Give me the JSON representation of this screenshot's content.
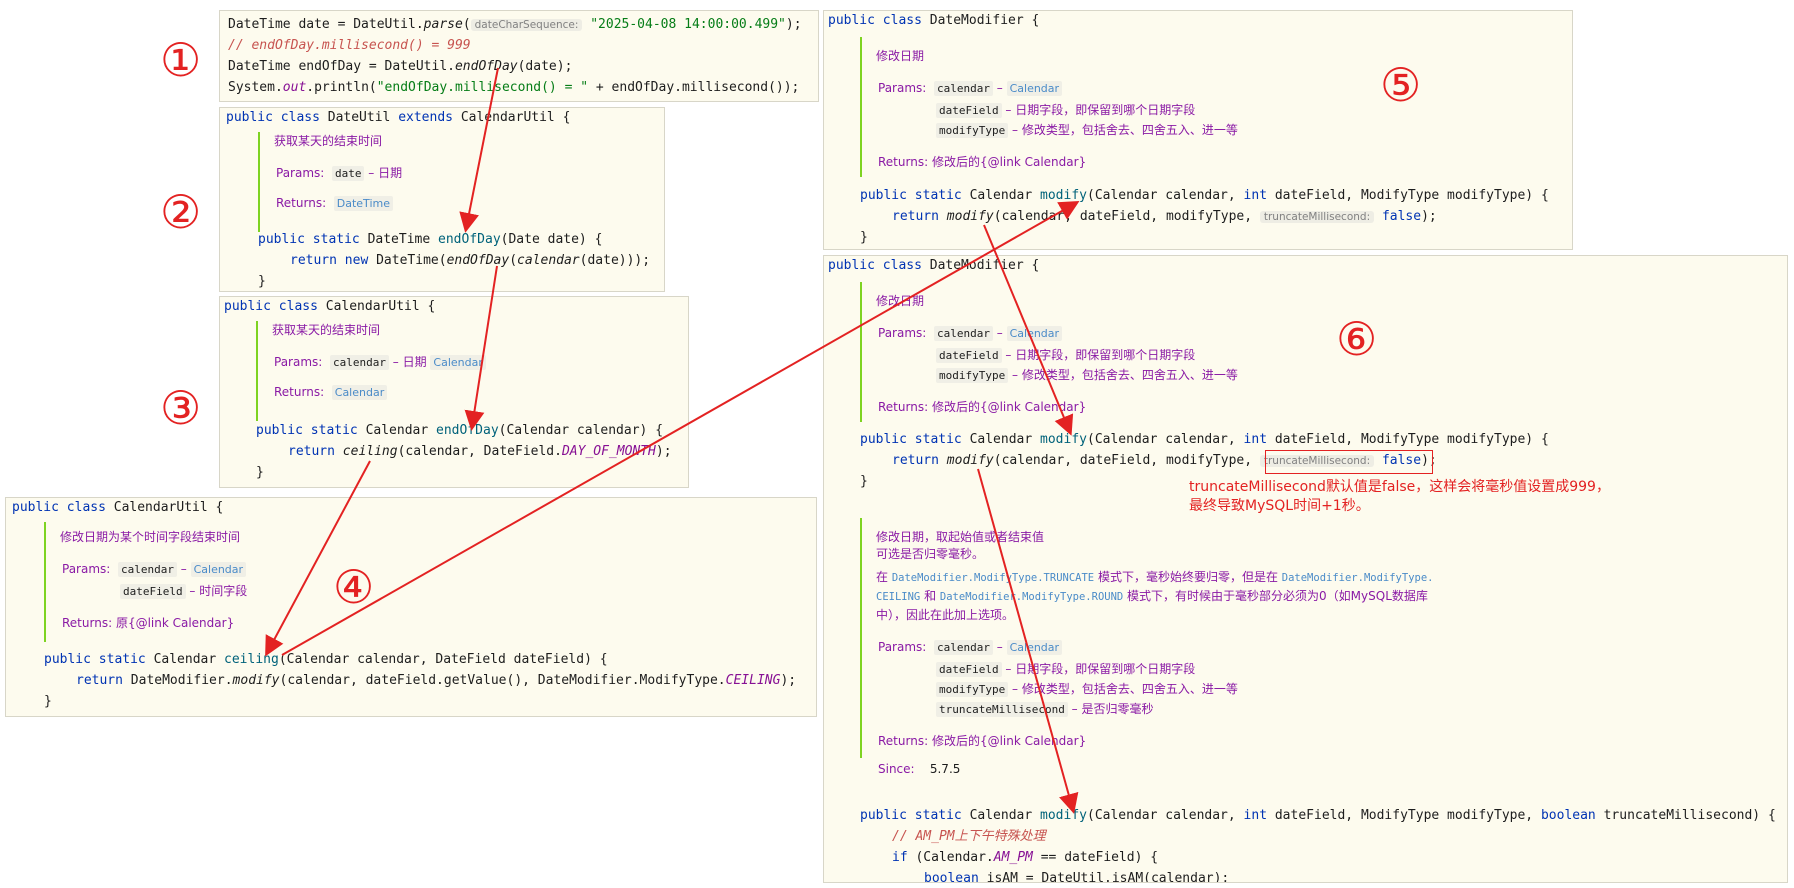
{
  "panel1": {
    "l1_a": "DateTime date = DateUtil.",
    "l1_fn": "parse",
    "l1_b": "(",
    "l1_hint": "dateCharSequence:",
    "l1_str": "\"2025-04-08 14:00:00.499\"",
    "l1_c": ");",
    "l2": "// endOfDay.millisecond() = 999",
    "l3_a": "DateTime endOfDay = DateUtil.",
    "l3_fn": "endOfDay",
    "l3_b": "(date);",
    "l4_a": "System.",
    "l4_out": "out",
    "l4_b": ".println(",
    "l4_str": "\"endOfDay.millisecond() = \"",
    "l4_c": " + endOfDay.millisecond());"
  },
  "panel2": {
    "header_kw": "public class",
    "header_name": " DateUtil ",
    "header_kw2": "extends",
    "header_rest": " CalendarUtil {",
    "doc_desc": "获取某天的结束时间",
    "doc_params": "Params:",
    "doc_param_name": "date",
    "doc_param_desc": " – 日期",
    "doc_returns": "Returns:",
    "doc_returns_type": "DateTime",
    "sig_kw": "public static",
    "sig_type": " DateTime ",
    "sig_fn": "endOfDay",
    "sig_rest": "(Date date) {",
    "body_kw": "return new",
    "body_a": " DateTime(",
    "body_fn": "endOfDay",
    "body_b": "(",
    "body_fn2": "calendar",
    "body_c": "(date)));",
    "close": "}"
  },
  "panel3": {
    "header_kw": "public class",
    "header_rest": " CalendarUtil {",
    "doc_desc": "获取某天的结束时间",
    "doc_params": "Params:",
    "doc_param_name": "calendar",
    "doc_param_desc": " – 日期 ",
    "doc_param_type": "Calendar",
    "doc_returns": "Returns:",
    "doc_returns_type": "Calendar",
    "sig_kw": "public static",
    "sig_type": " Calendar ",
    "sig_fn": "endOfDay",
    "sig_rest": "(Calendar calendar) {",
    "body_kw": "return",
    "body_fn": "ceiling",
    "body_a": "(calendar, DateField.",
    "body_cst": "DAY_OF_MONTH",
    "body_b": ");",
    "close": "}"
  },
  "panel4": {
    "header_kw": "public class",
    "header_rest": " CalendarUtil {",
    "doc_desc": "修改日期为某个时间字段结束时间",
    "doc_params": "Params:",
    "doc_p1_name": "calendar",
    "doc_p1_desc": " – ",
    "doc_p1_type": "Calendar",
    "doc_p2_name": "dateField",
    "doc_p2_desc": " – 时间字段",
    "doc_returns": "Returns:",
    "doc_returns_desc": " 原{@link Calendar}",
    "sig_kw": "public static",
    "sig_type": " Calendar ",
    "sig_fn": "ceiling",
    "sig_rest": "(Calendar calendar, DateField dateField) {",
    "body_kw": "return",
    "body_a": " DateModifier.",
    "body_fn": "modify",
    "body_b": "(calendar, dateField.getValue(), DateModifier.ModifyType.",
    "body_cst": "CEILING",
    "body_c": ");",
    "close": "}"
  },
  "panel5": {
    "header_kw": "public class",
    "header_rest": " DateModifier {",
    "doc_desc": "修改日期",
    "doc_params": "Params:",
    "doc_p1_name": "calendar",
    "doc_p1_desc": " – ",
    "doc_p1_type": "Calendar",
    "doc_p2_name": "dateField",
    "doc_p2_desc": " – 日期字段，即保留到哪个日期字段",
    "doc_p3_name": "modifyType",
    "doc_p3_desc": " – 修改类型，包括舍去、四舍五入、进一等",
    "doc_returns": "Returns:",
    "doc_returns_desc": " 修改后的{@link Calendar}",
    "sig_kw": "public static",
    "sig_type": " Calendar ",
    "sig_fn": "modify",
    "sig_a": "(Calendar calendar, ",
    "sig_int": "int",
    "sig_b": " dateField, ModifyType modifyType) {",
    "body_kw": "return",
    "body_fn": "modify",
    "body_a": "(calendar, dateField, modifyType, ",
    "body_hint": "truncateMillisecond:",
    "body_false": "false",
    "body_b": ");",
    "close": "}"
  },
  "panel6": {
    "header_kw": "public class",
    "header_rest": " DateModifier {",
    "doc_desc": "修改日期",
    "doc_params": "Params:",
    "doc_p1_name": "calendar",
    "doc_p1_desc": " – ",
    "doc_p1_type": "Calendar",
    "doc_p2_name": "dateField",
    "doc_p2_desc": " – 日期字段，即保留到哪个日期字段",
    "doc_p3_name": "modifyType",
    "doc_p3_desc": " – 修改类型，包括舍去、四舍五入、进一等",
    "doc_returns": "Returns:",
    "doc_returns_desc": " 修改后的{@link Calendar}",
    "sig_kw": "public static",
    "sig_type": " Calendar ",
    "sig_fn": "modify",
    "sig_a": "(Calendar calendar, ",
    "sig_int": "int",
    "sig_b": " dateField, ModifyType modifyType) {",
    "body_kw": "return",
    "body_fn": "modify",
    "body_a": "(calendar, dateField, modifyType, ",
    "body_hint": "truncateMillisecond:",
    "body_false": "false",
    "body_b": ");",
    "close": "}",
    "note1": "truncateMillisecond默认值是false，这样会将毫秒值设置成999，",
    "note2": "最终导致MySQL时间+1秒。",
    "doc2_desc1": "修改日期，取起始值或者结束值",
    "doc2_desc2": "可选是否归零毫秒。",
    "doc2_desc3_a": "在 ",
    "doc2_desc3_ref1": "DateModifier.ModifyType.TRUNCATE",
    "doc2_desc3_b": " 模式下，毫秒始终要归零，但是在 ",
    "doc2_desc3_ref2": "DateModifier.ModifyType.",
    "doc2_desc4_ref3": "CEILING",
    "doc2_desc4_a": " 和 ",
    "doc2_desc4_ref4": "DateModifier.ModifyType.ROUND",
    "doc2_desc4_b": " 模式下，有时候由于毫秒部分必须为0（如MySQL数据库",
    "doc2_desc5": "中），因此在此加上选项。",
    "doc2_params": "Params:",
    "doc2_p1_name": "calendar",
    "doc2_p1_desc": " – ",
    "doc2_p1_type": "Calendar",
    "doc2_p2_name": "dateField",
    "doc2_p2_desc": " – 日期字段，即保留到哪个日期字段",
    "doc2_p3_name": "modifyType",
    "doc2_p3_desc": " – 修改类型，包括舍去、四舍五入、进一等",
    "doc2_p4_name": "truncateMillisecond",
    "doc2_p4_desc": " – 是否归零毫秒",
    "doc2_returns": "Returns:",
    "doc2_returns_desc": " 修改后的{@link Calendar}",
    "doc2_since": "Since:",
    "doc2_since_val": "5.7.5",
    "sig2_kw": "public static",
    "sig2_type": " Calendar ",
    "sig2_fn": "modify",
    "sig2_a": "(Calendar calendar, ",
    "sig2_int": "int",
    "sig2_b": " dateField, ModifyType modifyType, ",
    "sig2_bool": "boolean",
    "sig2_c": " truncateMillisecond) {",
    "cmt2": "// AM_PM上下午特殊处理",
    "if_kw": "if",
    "if_a": " (Calendar.",
    "if_cst": "AM_PM",
    "if_b": " == dateField) {",
    "last_kw": "boolean",
    "last_a": " isAM = DateUtil.isAM(calendar);"
  },
  "markers": [
    "①",
    "②",
    "③",
    "④",
    "⑤",
    "⑥"
  ],
  "accent_red": "#e32222"
}
